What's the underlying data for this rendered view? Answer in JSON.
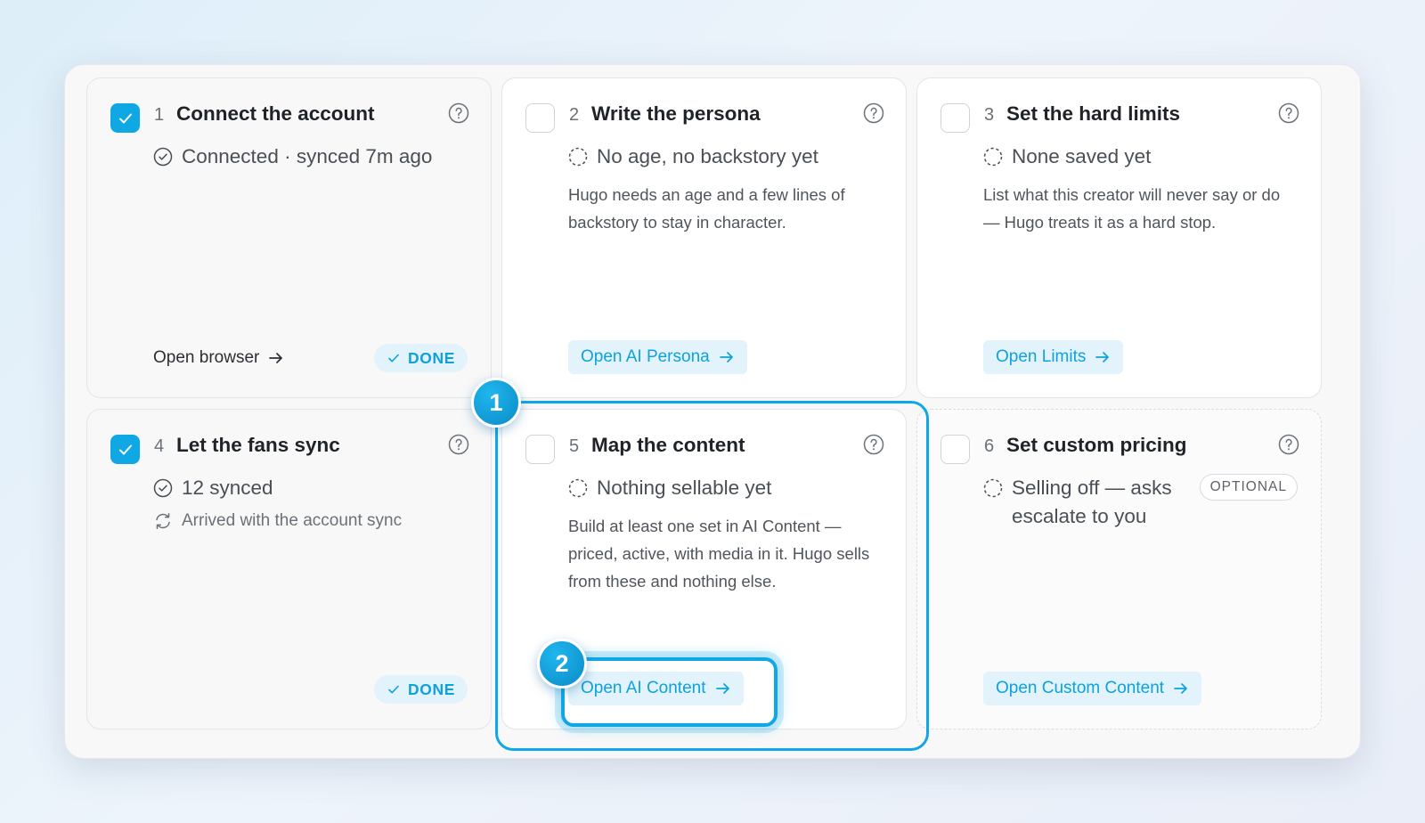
{
  "steps": [
    {
      "number": "1",
      "title": "Connect the account",
      "checked": true,
      "status": "Connected · synced 7m ago",
      "status_icon": "check-circle-icon",
      "link_label": "Open browser",
      "badge": "DONE"
    },
    {
      "number": "2",
      "title": "Write the persona",
      "checked": false,
      "status": "No age, no backstory yet",
      "status_icon": "dashed-circle-icon",
      "description": "Hugo needs an age and a few lines of backstory to stay in character.",
      "button_label": "Open AI Persona"
    },
    {
      "number": "3",
      "title": "Set the hard limits",
      "checked": false,
      "status": "None saved yet",
      "status_icon": "dashed-circle-icon",
      "description": "List what this creator will never say or do — Hugo treats it as a hard stop.",
      "button_label": "Open Limits"
    },
    {
      "number": "4",
      "title": "Let the fans sync",
      "checked": true,
      "status": "12 synced",
      "status_icon": "check-circle-icon",
      "subnote": "Arrived with the account sync",
      "subnote_icon": "sync-icon",
      "badge": "DONE"
    },
    {
      "number": "5",
      "title": "Map the content",
      "checked": false,
      "status": "Nothing sellable yet",
      "status_icon": "dashed-circle-icon",
      "description": "Build at least one set in AI Content — priced, active, with media in it. Hugo sells from these and nothing else.",
      "button_label": "Open AI Content"
    },
    {
      "number": "6",
      "title": "Set custom pricing",
      "checked": false,
      "status": "Selling off — asks escalate to you",
      "status_icon": "dashed-circle-icon",
      "tag": "OPTIONAL",
      "button_label": "Open Custom Content"
    }
  ],
  "annotations": {
    "marker_1": "1",
    "marker_2": "2"
  },
  "colors": {
    "accent": "#10a8e4",
    "accent_soft": "#e2f3fb"
  }
}
